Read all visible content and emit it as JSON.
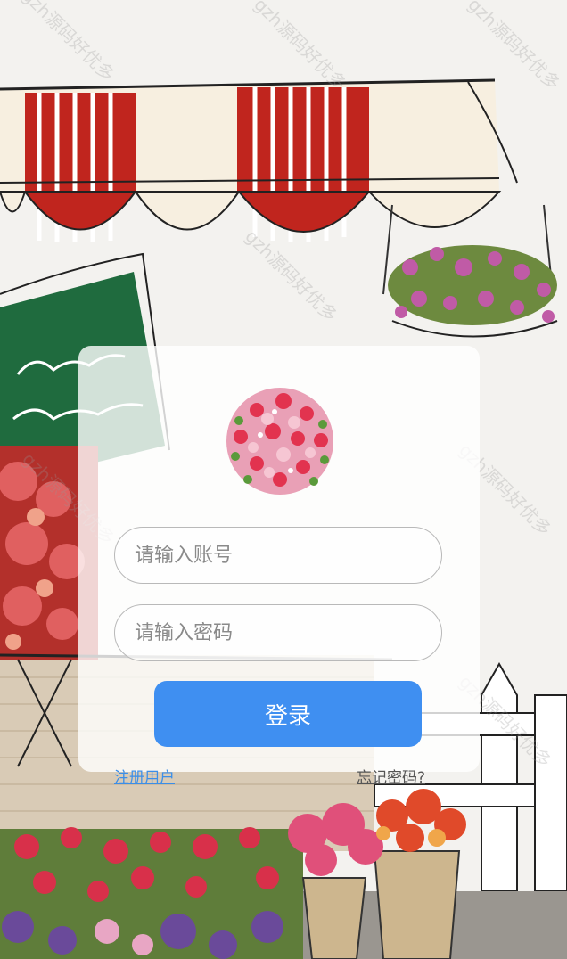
{
  "login": {
    "account_placeholder": "请输入账号",
    "password_placeholder": "请输入密码",
    "login_label": "登录",
    "register_label": "注册用户",
    "forgot_label": "忘记密码?"
  },
  "watermark": "gzh源码好优多",
  "colors": {
    "primary": "#3f8ff1",
    "link": "#3b8ee8",
    "awning_red": "#c0251e",
    "sign_green": "#1f6b3e"
  }
}
